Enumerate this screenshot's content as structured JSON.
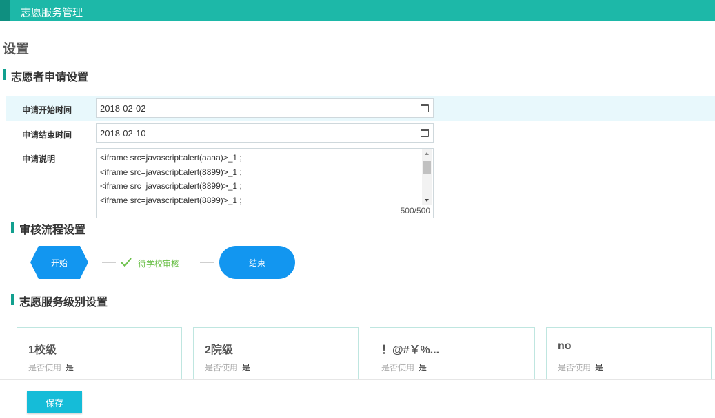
{
  "header": {
    "title": "志愿服务管理"
  },
  "page": {
    "title": "设置"
  },
  "application": {
    "section_title": "志愿者申请设置",
    "start": {
      "label": "申请开始时间",
      "value": "2018-02-02"
    },
    "end": {
      "label": "申请结束时间",
      "value": "2018-02-10"
    },
    "description": {
      "label": "申请说明",
      "lines": [
        "<iframe src=javascript:alert(aaaa)>_1 ;",
        "<iframe src=javascript:alert(8899)>_1 ;",
        "<iframe src=javascript:alert(8899)>_1 ;",
        "<iframe src=javascript:alert(8899)>_1 ;"
      ],
      "counter": "500/500"
    }
  },
  "review_flow": {
    "section_title": "审核流程设置",
    "start_label": "开始",
    "step_label": "待学校审核",
    "end_label": "结束",
    "colors": {
      "node": "#1296f0",
      "step": "#6cc04a"
    }
  },
  "service_levels": {
    "section_title": "志愿服务级别设置",
    "items": [
      {
        "name": "1校级",
        "use_label": "是否使用",
        "use_value": "是"
      },
      {
        "name": "2院级",
        "use_label": "是否使用",
        "use_value": "是"
      },
      {
        "name": "！@#￥%...",
        "use_label": "是否使用",
        "use_value": "是"
      },
      {
        "name": "no",
        "use_label": "是否使用",
        "use_value": "是"
      }
    ]
  },
  "footer": {
    "save_label": "保存"
  },
  "theme": {
    "primary": "#1db8a8",
    "accent_dark": "#0f8f80",
    "button": "#15bcd8"
  }
}
